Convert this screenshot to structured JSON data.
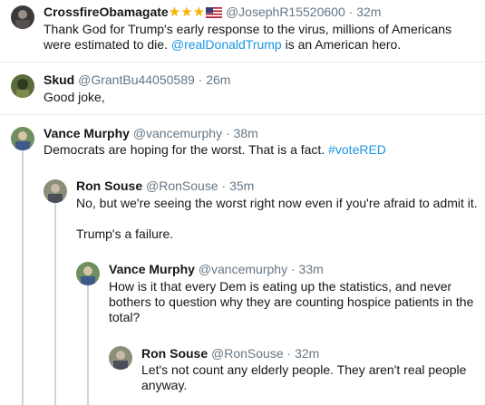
{
  "tweets": [
    {
      "name": "CrossfireObamagate",
      "decoration": [
        "star-icon",
        "star-icon",
        "star-icon",
        "us-flag-icon"
      ],
      "handle": "@JosephR15520600",
      "sep": "·",
      "time": "32m",
      "text_1": "Thank God for Trump's early response to the virus, millions of Americans were estimated to die. ",
      "mention": "@realDonaldTrump",
      "text_2": " is an American hero."
    },
    {
      "name": "Skud",
      "handle": "@GrantBu44050589",
      "sep": "·",
      "time": "26m",
      "text": "Good joke,"
    },
    {
      "name": "Vance Murphy",
      "handle": "@vancemurphy",
      "sep": "·",
      "time": "38m",
      "text_1": "Democrats are hoping for the worst. That is a fact. ",
      "hashtag": "#voteRED"
    },
    {
      "name": "Ron Souse",
      "handle": "@RonSouse",
      "sep": "·",
      "time": "35m",
      "para_1": "No, but we're seeing the worst right now even if you're afraid to admit it.",
      "para_2": "Trump's a failure."
    },
    {
      "name": "Vance Murphy",
      "handle": "@vancemurphy",
      "sep": "·",
      "time": "33m",
      "text": "How is it that every Dem is eating up the statistics, and never bothers to question why they are counting hospice patients in the total?"
    },
    {
      "name": "Ron Souse",
      "handle": "@RonSouse",
      "sep": "·",
      "time": "32m",
      "text": "Let's not count any elderly people.  They aren't real people anyway."
    }
  ]
}
